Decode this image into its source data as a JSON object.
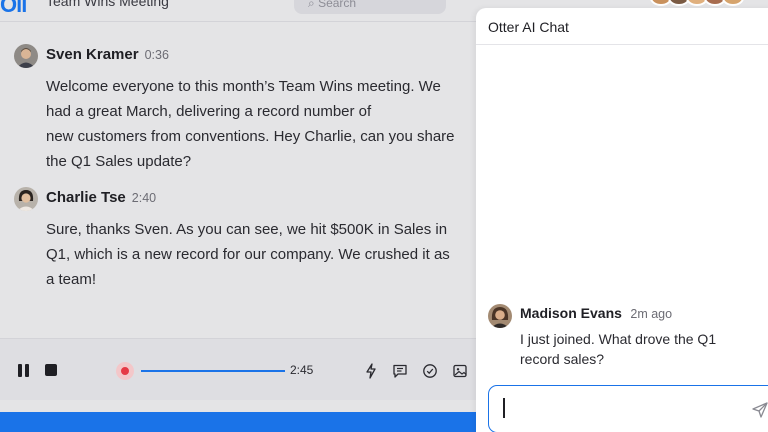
{
  "header": {
    "logo": "Oll",
    "meeting_title": "Team Wins Meeting",
    "search_placeholder": "Search"
  },
  "transcript": [
    {
      "speaker": "Sven Kramer",
      "timestamp": "0:36",
      "lines": [
        "Welcome everyone to this month’s Team Wins meeting. We",
        "had a great March, delivering a record number of",
        "new customers from conventions. Hey Charlie, can you share",
        "the Q1 Sales update?"
      ]
    },
    {
      "speaker": "Charlie Tse",
      "timestamp": "2:40",
      "lines": [
        "Sure, thanks Sven. As you can see, we hit $500K in Sales in",
        "Q1, which is a new record for our company. We crushed it as",
        "a team!"
      ]
    }
  ],
  "player": {
    "current_time": "2:45",
    "progress": 1.0,
    "accent_color": "#1a73e8",
    "record_color": "#e53945",
    "icons": [
      "pause-icon",
      "stop-icon",
      "record-icon",
      "highlight-icon",
      "comment-icon",
      "action-item-icon",
      "image-icon"
    ]
  },
  "chat": {
    "title": "Otter AI Chat",
    "message": {
      "author": "Madison Evans",
      "time": "2m ago",
      "lines": [
        "I just joined. What drove the Q1",
        "record sales?"
      ]
    },
    "input_value": ""
  }
}
